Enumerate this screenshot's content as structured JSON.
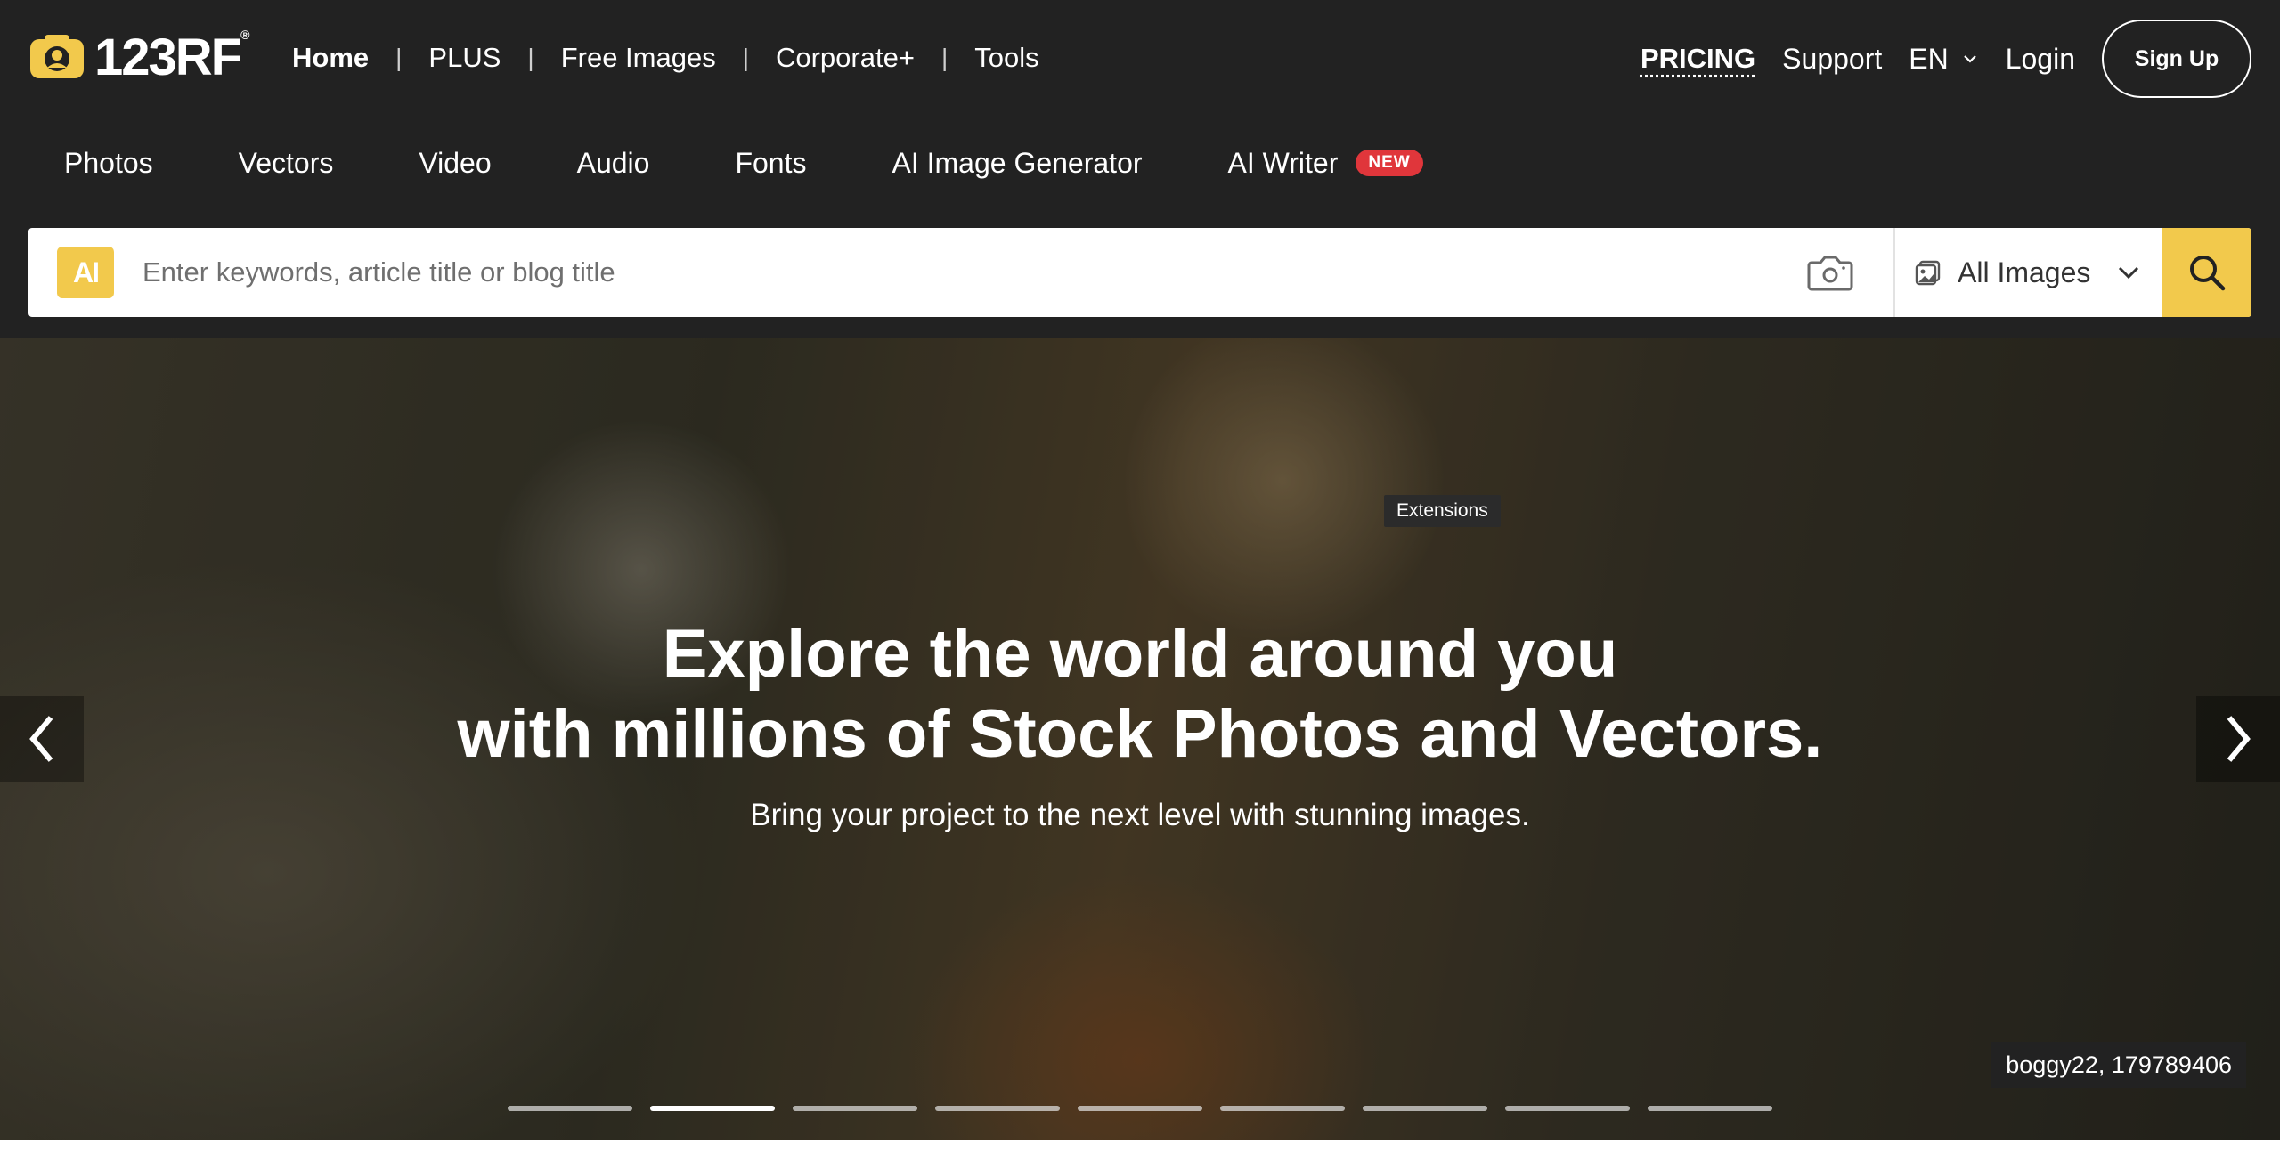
{
  "header": {
    "logo_text": "123RF",
    "logo_reg": "®",
    "top_nav": [
      "Home",
      "PLUS",
      "Free Images",
      "Corporate+",
      "Tools"
    ],
    "pricing": "PRICING",
    "support": "Support",
    "language": "EN",
    "login": "Login",
    "signup": "Sign Up"
  },
  "categories": [
    "Photos",
    "Vectors",
    "Video",
    "Audio",
    "Fonts",
    "AI Image Generator"
  ],
  "ai_writer": {
    "label": "AI Writer",
    "badge": "NEW"
  },
  "search": {
    "ai_badge": "AI",
    "placeholder": "Enter keywords, article title or blog title",
    "type": "All Images"
  },
  "hero": {
    "title_line1": "Explore the world around you",
    "title_line2": "with millions of Stock Photos and Vectors.",
    "subtitle": "Bring your project to the next level with stunning images.",
    "tooltip": "Extensions",
    "credit": "boggy22, 179789406",
    "slide_count": 9,
    "active_slide_index": 1
  },
  "colors": {
    "header_bg": "#222222",
    "accent_yellow": "#f2c94c",
    "new_badge": "#e0363b"
  }
}
